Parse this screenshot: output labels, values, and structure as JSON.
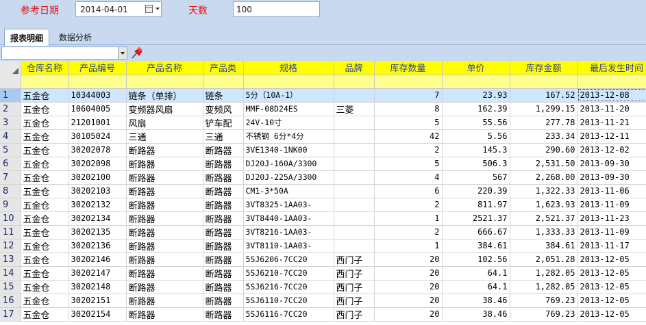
{
  "filters": {
    "ref_date_label": "参考日期",
    "ref_date_value": "2014-04-01",
    "days_label": "天数",
    "days_value": "100"
  },
  "tabs": [
    {
      "label": "报表明细",
      "active": true
    },
    {
      "label": "数据分析",
      "active": false
    }
  ],
  "toolbar": {
    "combo_value": "",
    "pin_icon": "pushpin-icon"
  },
  "colors": {
    "header_bg": "#ffff00",
    "header_text": "#2a3fa0",
    "label_red": "#e81010",
    "selected_row": "#cfe6ff"
  },
  "table": {
    "columns": [
      "仓库名称",
      "产品编号",
      "产品名称",
      "产品类",
      "规格",
      "品牌",
      "库存数量",
      "单价",
      "库存金额",
      "最后发生时间"
    ],
    "rows": [
      [
        "1",
        "五金仓",
        "10344003",
        "链条（单排）",
        "链条",
        "5分（10A-1）",
        "",
        "7",
        "23.93",
        "167.52",
        "2013-12-08"
      ],
      [
        "2",
        "五金仓",
        "10604005",
        "变频器风扇",
        "变频风",
        "MMF-08D24ES",
        "三菱",
        "8",
        "162.39",
        "1,299.15",
        "2013-11-20"
      ],
      [
        "3",
        "五金仓",
        "21201001",
        "风扇",
        "铲车配",
        "24V-10寸",
        "",
        "5",
        "55.56",
        "277.78",
        "2013-11-21"
      ],
      [
        "4",
        "五金仓",
        "30105024",
        "三通",
        "三通",
        "不锈钢 6分*4分",
        "",
        "42",
        "5.56",
        "233.34",
        "2013-12-11"
      ],
      [
        "5",
        "五金仓",
        "30202078",
        "断路器",
        "断路器",
        "3VE1340-1NK00",
        "",
        "2",
        "145.3",
        "290.60",
        "2013-12-02"
      ],
      [
        "6",
        "五金仓",
        "30202098",
        "断路器",
        "断路器",
        "DJ20J-160A/3300",
        "",
        "5",
        "506.3",
        "2,531.50",
        "2013-09-30"
      ],
      [
        "7",
        "五金仓",
        "30202100",
        "断路器",
        "断路器",
        "DJ20J-225A/3300",
        "",
        "4",
        "567",
        "2,268.00",
        "2013-09-30"
      ],
      [
        "8",
        "五金仓",
        "30202103",
        "断路器",
        "断路器",
        "CM1-3*50A",
        "",
        "6",
        "220.39",
        "1,322.33",
        "2013-11-06"
      ],
      [
        "9",
        "五金仓",
        "30202132",
        "断路器",
        "断路器",
        "3VT8325-1AA03-",
        "",
        "2",
        "811.97",
        "1,623.93",
        "2013-11-09"
      ],
      [
        "10",
        "五金仓",
        "30202134",
        "断路器",
        "断路器",
        "3VT8440-1AA03-",
        "",
        "1",
        "2521.37",
        "2,521.37",
        "2013-11-23"
      ],
      [
        "11",
        "五金仓",
        "30202135",
        "断路器",
        "断路器",
        "3VT8216-1AA03-",
        "",
        "2",
        "666.67",
        "1,333.33",
        "2013-11-09"
      ],
      [
        "12",
        "五金仓",
        "30202136",
        "断路器",
        "断路器",
        "3VT8110-1AA03-",
        "",
        "1",
        "384.61",
        "384.61",
        "2013-11-17"
      ],
      [
        "13",
        "五金仓",
        "30202146",
        "断路器",
        "断路器",
        "5SJ6206-7CC20",
        "西门子",
        "20",
        "102.56",
        "2,051.28",
        "2013-12-05"
      ],
      [
        "14",
        "五金仓",
        "30202147",
        "断路器",
        "断路器",
        "5SJ6210-7CC20",
        "西门子",
        "20",
        "64.1",
        "1,282.05",
        "2013-12-05"
      ],
      [
        "15",
        "五金仓",
        "30202148",
        "断路器",
        "断路器",
        "5SJ6216-7CC20",
        "西门子",
        "20",
        "64.1",
        "1,282.05",
        "2013-12-05"
      ],
      [
        "16",
        "五金仓",
        "30202151",
        "断路器",
        "断路器",
        "5SJ6110-7CC20",
        "西门子",
        "20",
        "38.46",
        "769.23",
        "2013-12-05"
      ],
      [
        "17",
        "五金仓",
        "30202154",
        "断路器",
        "断路器",
        "5SJ6116-7CC20",
        "西门子",
        "20",
        "38.46",
        "769.23",
        "2013-12-05"
      ]
    ]
  }
}
